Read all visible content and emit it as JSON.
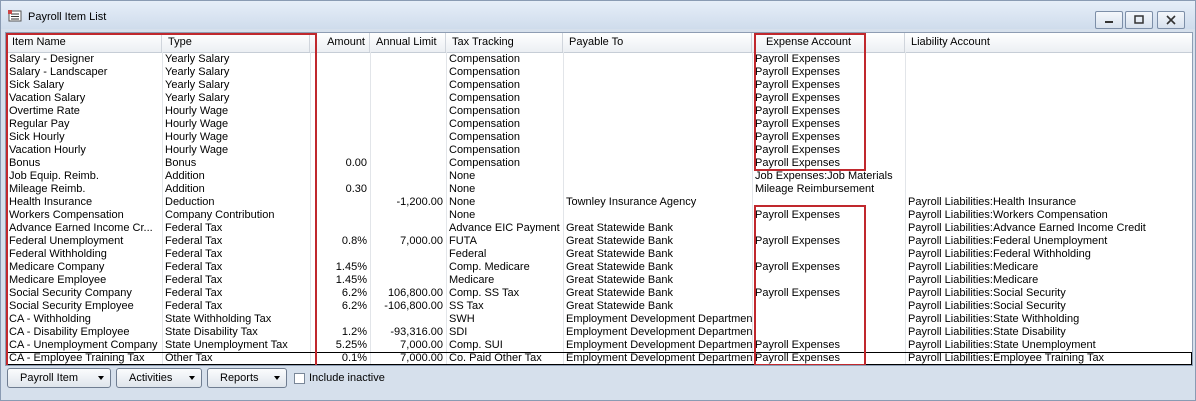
{
  "window": {
    "title": "Payroll Item List"
  },
  "columns": {
    "item_name": "Item Name",
    "type": "Type",
    "amount": "Amount",
    "annual_limit": "Annual Limit",
    "tax_tracking": "Tax Tracking",
    "payable_to": "Payable To",
    "expense_account": "Expense Account",
    "liability_account": "Liability Account"
  },
  "rows": [
    {
      "name": "Salary - Designer",
      "type": "Yearly Salary",
      "amount": "",
      "limit": "",
      "tax": "Compensation",
      "payable": "",
      "expense": "Payroll Expenses",
      "liability": ""
    },
    {
      "name": "Salary - Landscaper",
      "type": "Yearly Salary",
      "amount": "",
      "limit": "",
      "tax": "Compensation",
      "payable": "",
      "expense": "Payroll Expenses",
      "liability": ""
    },
    {
      "name": "Sick Salary",
      "type": "Yearly Salary",
      "amount": "",
      "limit": "",
      "tax": "Compensation",
      "payable": "",
      "expense": "Payroll Expenses",
      "liability": ""
    },
    {
      "name": "Vacation Salary",
      "type": "Yearly Salary",
      "amount": "",
      "limit": "",
      "tax": "Compensation",
      "payable": "",
      "expense": "Payroll Expenses",
      "liability": ""
    },
    {
      "name": "Overtime Rate",
      "type": "Hourly Wage",
      "amount": "",
      "limit": "",
      "tax": "Compensation",
      "payable": "",
      "expense": "Payroll Expenses",
      "liability": ""
    },
    {
      "name": "Regular Pay",
      "type": "Hourly Wage",
      "amount": "",
      "limit": "",
      "tax": "Compensation",
      "payable": "",
      "expense": "Payroll Expenses",
      "liability": ""
    },
    {
      "name": "Sick Hourly",
      "type": "Hourly Wage",
      "amount": "",
      "limit": "",
      "tax": "Compensation",
      "payable": "",
      "expense": "Payroll Expenses",
      "liability": ""
    },
    {
      "name": "Vacation Hourly",
      "type": "Hourly Wage",
      "amount": "",
      "limit": "",
      "tax": "Compensation",
      "payable": "",
      "expense": "Payroll Expenses",
      "liability": ""
    },
    {
      "name": "Bonus",
      "type": "Bonus",
      "amount": "0.00",
      "limit": "",
      "tax": "Compensation",
      "payable": "",
      "expense": "Payroll Expenses",
      "liability": ""
    },
    {
      "name": "Job Equip. Reimb.",
      "type": "Addition",
      "amount": "",
      "limit": "",
      "tax": "None",
      "payable": "",
      "expense": "Job Expenses:Job Materials",
      "liability": ""
    },
    {
      "name": "Mileage Reimb.",
      "type": "Addition",
      "amount": "0.30",
      "limit": "",
      "tax": "None",
      "payable": "",
      "expense": "Mileage Reimbursement",
      "liability": ""
    },
    {
      "name": "Health Insurance",
      "type": "Deduction",
      "amount": "",
      "limit": "-1,200.00",
      "tax": "None",
      "payable": "Townley Insurance Agency",
      "expense": "",
      "liability": "Payroll Liabilities:Health Insurance"
    },
    {
      "name": "Workers Compensation",
      "type": "Company Contribution",
      "amount": "",
      "limit": "",
      "tax": "None",
      "payable": "",
      "expense": "Payroll Expenses",
      "liability": "Payroll Liabilities:Workers Compensation"
    },
    {
      "name": "Advance Earned Income Cr...",
      "type": "Federal Tax",
      "amount": "",
      "limit": "",
      "tax": "Advance EIC Payment",
      "payable": "Great Statewide Bank",
      "expense": "",
      "liability": "Payroll Liabilities:Advance Earned Income Credit"
    },
    {
      "name": "Federal Unemployment",
      "type": "Federal Tax",
      "amount": "0.8%",
      "limit": "7,000.00",
      "tax": "FUTA",
      "payable": "Great Statewide Bank",
      "expense": "Payroll Expenses",
      "liability": "Payroll Liabilities:Federal Unemployment"
    },
    {
      "name": "Federal Withholding",
      "type": "Federal Tax",
      "amount": "",
      "limit": "",
      "tax": "Federal",
      "payable": "Great Statewide Bank",
      "expense": "",
      "liability": "Payroll Liabilities:Federal Withholding"
    },
    {
      "name": "Medicare Company",
      "type": "Federal Tax",
      "amount": "1.45%",
      "limit": "",
      "tax": "Comp. Medicare",
      "payable": "Great Statewide Bank",
      "expense": "Payroll Expenses",
      "liability": "Payroll Liabilities:Medicare"
    },
    {
      "name": "Medicare Employee",
      "type": "Federal Tax",
      "amount": "1.45%",
      "limit": "",
      "tax": "Medicare",
      "payable": "Great Statewide Bank",
      "expense": "",
      "liability": "Payroll Liabilities:Medicare"
    },
    {
      "name": "Social Security Company",
      "type": "Federal Tax",
      "amount": "6.2%",
      "limit": "106,800.00",
      "tax": "Comp. SS Tax",
      "payable": "Great Statewide Bank",
      "expense": "Payroll Expenses",
      "liability": "Payroll Liabilities:Social Security"
    },
    {
      "name": "Social Security Employee",
      "type": "Federal Tax",
      "amount": "6.2%",
      "limit": "-106,800.00",
      "tax": "SS Tax",
      "payable": "Great Statewide Bank",
      "expense": "",
      "liability": "Payroll Liabilities:Social Security"
    },
    {
      "name": "CA - Withholding",
      "type": "State Withholding Tax",
      "amount": "",
      "limit": "",
      "tax": "SWH",
      "payable": "Employment Development Department",
      "expense": "",
      "liability": "Payroll Liabilities:State Withholding"
    },
    {
      "name": "CA - Disability Employee",
      "type": "State Disability Tax",
      "amount": "1.2%",
      "limit": "-93,316.00",
      "tax": "SDI",
      "payable": "Employment Development Department",
      "expense": "",
      "liability": "Payroll Liabilities:State Disability"
    },
    {
      "name": "CA - Unemployment Company",
      "type": "State Unemployment Tax",
      "amount": "5.25%",
      "limit": "7,000.00",
      "tax": "Comp. SUI",
      "payable": "Employment Development Department",
      "expense": "Payroll Expenses",
      "liability": "Payroll Liabilities:State Unemployment"
    },
    {
      "name": "CA - Employee Training Tax",
      "type": "Other Tax",
      "amount": "0.1%",
      "limit": "7,000.00",
      "tax": "Co. Paid Other Tax",
      "payable": "Employment Development Department",
      "expense": "Payroll Expenses",
      "liability": "Payroll Liabilities:Employee Training Tax"
    }
  ],
  "toolbar": {
    "payroll_item_label": "Payroll Item",
    "activities_label": "Activities",
    "reports_label": "Reports",
    "include_inactive_label": "Include inactive",
    "include_inactive_checked": false
  },
  "icons": {
    "title": "payroll-list-icon",
    "minimize": "minimize-icon",
    "restore": "restore-icon",
    "close": "close-icon",
    "dropdown": "chevron-down-icon"
  },
  "colors": {
    "highlight_box": "#c0282d",
    "title_bg": "#d6e0ec"
  }
}
